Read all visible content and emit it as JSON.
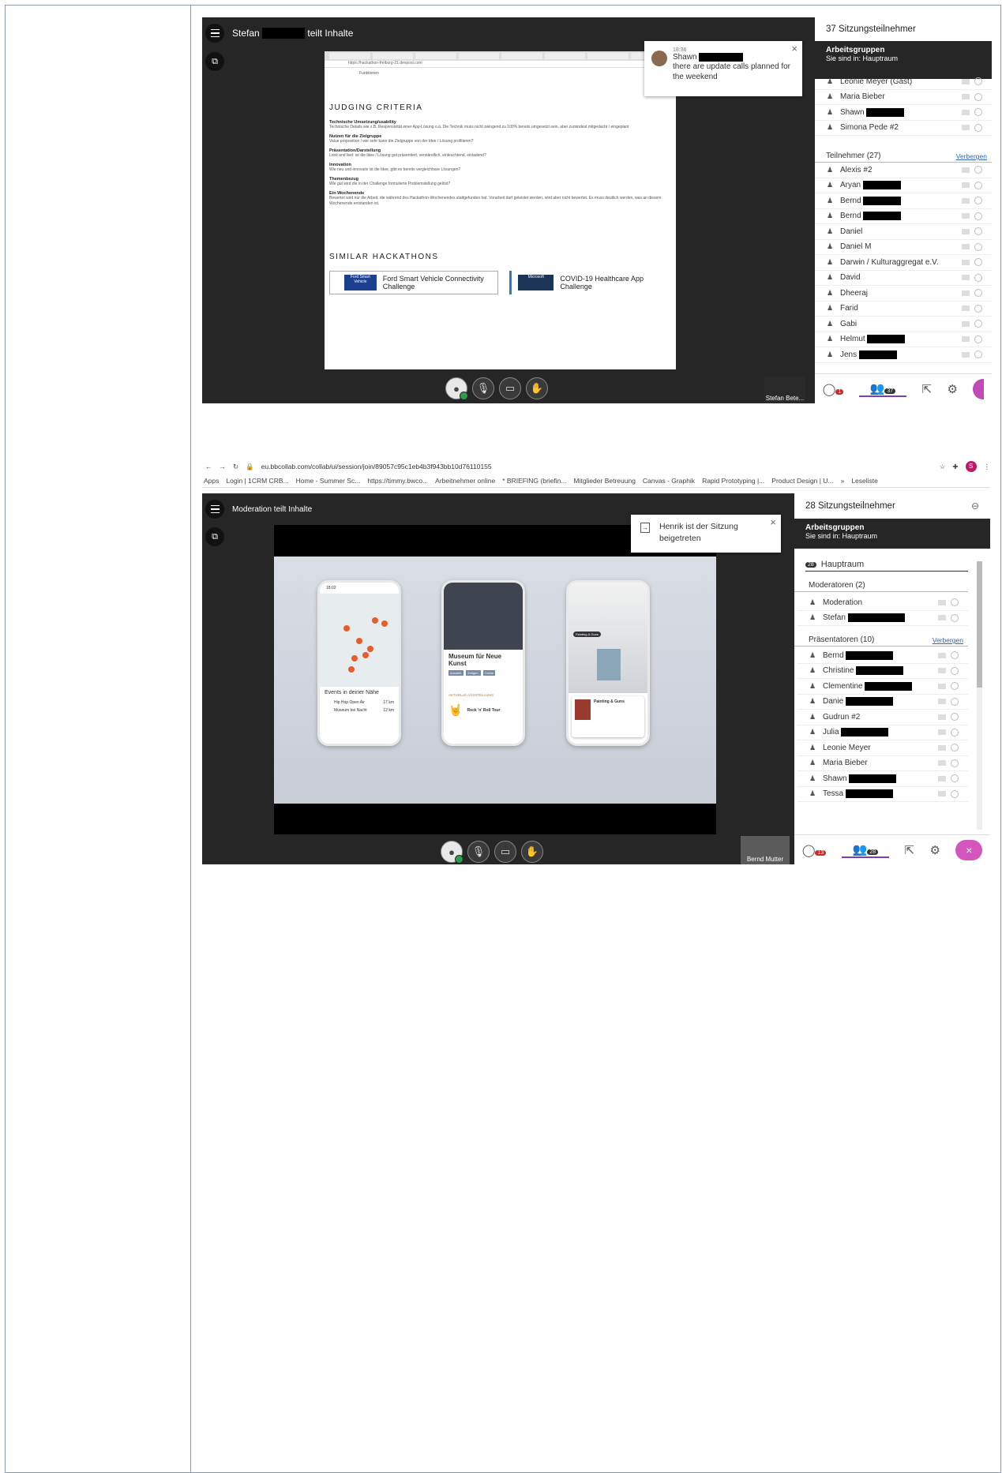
{
  "screen1": {
    "presenter_prefix": "Stefan",
    "presenter_suffix": "teilt Inhalte",
    "toast": {
      "time": "18:36",
      "sender": "Shawn",
      "message": "there are update calls planned for the weekend"
    },
    "website": {
      "url": "https://hackathon-freiburg-21.devpost.com",
      "cut_top": "Funktionen",
      "heading": "JUDGING CRITERIA",
      "criteria": [
        {
          "title": "Technische Umsetzung/usability",
          "text": "Technische Details wie z.B. Responsivität einer App-Lösung o.ä. Die Technik muss nicht zwingend zu 100% bereits umgesetzt sein, aber zumindest mitgedacht / eingeplant"
        },
        {
          "title": "Nutzen für die Zielgruppe",
          "text": "Value proposition / wie sehr kann die Zielgruppe von der Idee / Lösung profitieren?"
        },
        {
          "title": "Präsentation/Darstellung",
          "text": "Look and feel: ist die Idee / Lösung gut präsentiert, verständlich, einleuchtend, einladend?"
        },
        {
          "title": "Innovation",
          "text": "Wie neu und innovativ ist die Idee, gibt es bereits vergleichbare Lösungen?"
        },
        {
          "title": "Themenbezug",
          "text": "Wie gut wird die in der Challenge formulierte Problemstellung gelöst?"
        },
        {
          "title": "Ein Wochenende",
          "text": "Bewertet wird nur die Arbeit, die während des Hackathon-Wochenendes stattgefunden hat. Vorarbeit darf geleistet werden, wird aber nicht bewertet. Es muss deutlich werden, was an diesem Wochenende entstanden ist."
        }
      ],
      "similar_heading": "SIMILAR HACKATHONS",
      "similar": [
        {
          "logo": "Ford Smart Vehicle",
          "title": "Ford Smart Vehicle Connectivity Challenge"
        },
        {
          "logo": "Microsoft",
          "title": "COVID-19 Healthcare App Challenge"
        }
      ]
    },
    "panel": {
      "title": "37 Sitzungsteilnehmer",
      "groups_title": "Arbeitsgruppen",
      "groups_sub": "Sie sind in: Hauptraum",
      "top_list": [
        "Leonie Meyer (Gast)",
        "Maria Bieber",
        "Shawn",
        "Simona Pede #2"
      ],
      "section_label": "Teilnehmer (27)",
      "section_link": "Verbergen",
      "participants": [
        "Alexis #2",
        "Aryan",
        "Bernd",
        "Bernd",
        "Daniel",
        "Daniel M",
        "Darwin / Kulturaggregat e.V.",
        "David",
        "Dheeraj",
        "Farid",
        "Gabi",
        "Helmut",
        "Jens"
      ],
      "chat_badge": "1",
      "people_badge": "37"
    },
    "camera_label": "Stefan Bete..."
  },
  "screen2": {
    "url": "eu.bbcollab.com/collab/ui/session/join/89057c95c1eb4b3f943bb10d76110155",
    "bookmarks": [
      "Apps",
      "Login | 1CRM CRB...",
      "Home - Summer Sc...",
      "https://timmy.bwco...",
      "Arbeitnehmer online",
      "* BRIEFING (briefin...",
      "Mitglieder Betreuung",
      "Canvas - Graphik",
      "Rapid Prototyping |...",
      "Product Design | U...",
      "»",
      "Leseliste"
    ],
    "presenter_label": "Moderation teilt Inhalte",
    "toast": "Henrik ist der Sitzung beigetreten",
    "panel": {
      "title": "28 Sitzungsteilnehmer",
      "groups_title": "Arbeitsgruppen",
      "groups_sub": "Sie sind in: Hauptraum",
      "room_badge": "28",
      "room": "Hauptraum",
      "moderators_label": "Moderatoren (2)",
      "moderators": [
        "Moderation",
        "Stefan"
      ],
      "presenters_label": "Präsentatoren (10)",
      "presenters_link": "Verbergen",
      "presenters": [
        "Bernd",
        "Christine",
        "Clementine",
        "Danie",
        "Gudrun #2",
        "Julia",
        "Leonie Meyer",
        "Maria Bieber",
        "Shawn",
        "Tessa"
      ],
      "chat_badge": "13",
      "people_badge": "28"
    },
    "phones": {
      "p1_time": "18:02",
      "p1_section": "Events in deiner Nähe",
      "p1_events": [
        {
          "name": "Hip Hop Open Air",
          "dist": "17 km"
        },
        {
          "name": "Museum bei Nacht",
          "dist": "12 km"
        }
      ],
      "p2_title": "Museum für Neue Kunst",
      "p2_tags": [
        "Ausstell.",
        "Zeitgen.",
        "Online"
      ],
      "p2_section": "AKTUELLE AUSSTELLUNG",
      "p2_event": "Rock 'n' Roll Tour",
      "p3_label": "Painting & Guns",
      "p3_card": "Painting & Guns"
    },
    "camera_label": "Bernd Mutter"
  }
}
